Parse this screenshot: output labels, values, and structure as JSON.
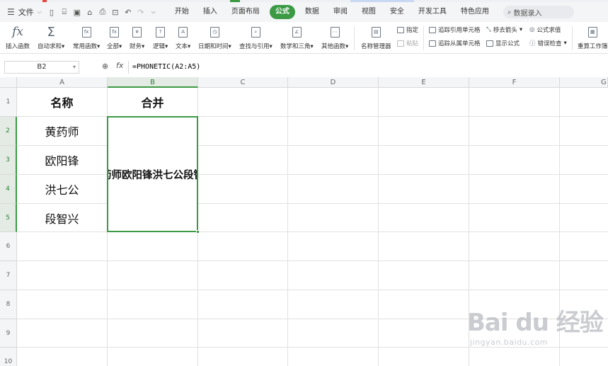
{
  "colors": {
    "accent": "#3c9a45",
    "menu_bg": "#f4f5f7",
    "grid_line": "#e1e1e1",
    "tab_strip": [
      "#e8453c",
      "#3c9a45",
      "#4a7fd6"
    ]
  },
  "menubar": {
    "file_label": "文件",
    "quick_access_icons": [
      "new-icon",
      "open-icon",
      "save-icon",
      "format-painter-icon",
      "print-icon",
      "print-preview-icon",
      "undo-icon",
      "redo-icon",
      "more-icon"
    ],
    "tabs": [
      {
        "label": "开始",
        "active": false
      },
      {
        "label": "插入",
        "active": false
      },
      {
        "label": "页面布局",
        "active": false
      },
      {
        "label": "公式",
        "active": true
      },
      {
        "label": "数据",
        "active": false
      },
      {
        "label": "审阅",
        "active": false
      },
      {
        "label": "视图",
        "active": false
      },
      {
        "label": "安全",
        "active": false
      },
      {
        "label": "开发工具",
        "active": false
      },
      {
        "label": "特色应用",
        "active": false
      }
    ],
    "search_placeholder": "数据录入"
  },
  "ribbon": {
    "insert_function": "插入函数",
    "autosum": "自动求和",
    "common_functions": "常用函数",
    "all": "全部",
    "financial": "财务",
    "logical": "逻辑",
    "text": "文本",
    "datetime": "日期和时间",
    "lookup": "查找与引用",
    "math": "数学和三角",
    "other": "其他函数",
    "name_manager": "名称管理器",
    "specify": "指定",
    "paste": "粘贴",
    "trace_precedents": "追踪引用单元格",
    "trace_dependents": "追踪从属单元格",
    "remove_arrows": "移去箭头",
    "show_formulas": "显示公式",
    "evaluate_formula": "公式求值",
    "error_check": "错误检查",
    "recalc": "重算工作簿"
  },
  "formula_bar": {
    "name_box": "B2",
    "fx": "fx",
    "formula": "=PHONETIC(A2:A5)"
  },
  "sheet": {
    "columns": [
      "A",
      "B",
      "C",
      "D",
      "E",
      "F",
      "G"
    ],
    "rows": [
      "1",
      "2",
      "3",
      "4",
      "5",
      "6",
      "7",
      "8",
      "9",
      "10"
    ],
    "selected_column": "B",
    "selected_rows": [
      "2",
      "3",
      "4",
      "5"
    ],
    "cells": {
      "A1": "名称",
      "B1": "合并",
      "A2": "黄药师",
      "A3": "欧阳锋",
      "A4": "洪七公",
      "A5": "段智兴"
    },
    "merged_B2_B5": "黄药师欧阳锋洪七公段智兴"
  },
  "watermark": {
    "logo": "Bai du 经验",
    "url": "jingyan.baidu.com"
  }
}
